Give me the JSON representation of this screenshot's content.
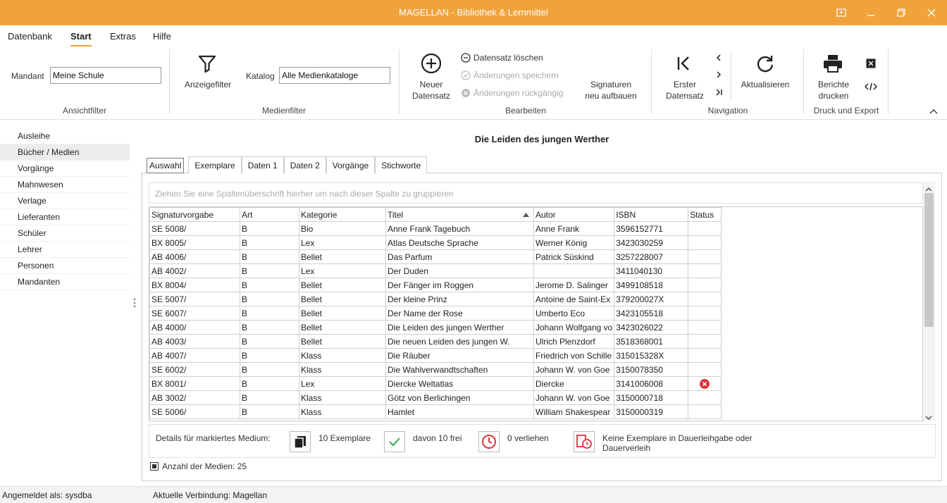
{
  "window": {
    "title": "MAGELLAN - Bibliothek & Lernmittel"
  },
  "menu": [
    "Datenbank",
    "Start",
    "Extras",
    "Hilfe"
  ],
  "ribbon": {
    "mandant_label": "Mandant",
    "mandant_value": "Meine Schule",
    "group_ansichtfilter": "Ansichtfilter",
    "anzeigefilter": "Anzeigefilter",
    "katalog_label": "Katalog",
    "katalog_value": "Alle Medienkataloge",
    "group_medienfilter": "Medienfilter",
    "neuer_datensatz_1": "Neuer",
    "neuer_datensatz_2": "Datensatz",
    "datensatz_loeschen": "Datensatz löschen",
    "aenderungen_speichern": "Änderungen speichern",
    "aenderungen_rueckgaengig": "Änderungen rückgängig",
    "signaturen_1": "Signaturen",
    "signaturen_2": "neu aufbauen",
    "group_bearbeiten": "Bearbeiten",
    "erster_1": "Erster",
    "erster_2": "Datensatz",
    "aktualisieren": "Aktualisieren",
    "group_navigation": "Navigation",
    "berichte_1": "Berichte",
    "berichte_2": "drucken",
    "group_druck": "Druck und Export"
  },
  "sidebar": [
    "Ausleihe",
    "Bücher / Medien",
    "Vorgänge",
    "Mahnwesen",
    "Verlage",
    "Lieferanten",
    "Schüler",
    "Lehrer",
    "Personen",
    "Mandanten"
  ],
  "main": {
    "title": "Die Leiden des jungen Werther",
    "tabs": [
      "Auswahl",
      "Exemplare",
      "Daten 1",
      "Daten 2",
      "Vorgänge",
      "Stichworte"
    ],
    "group_hint": "Ziehen Sie eine Spaltenüberschrift hierher um nach dieser Spalte zu gruppieren",
    "columns": [
      "Signaturvorgabe",
      "Art",
      "Kategorie",
      "Titel",
      "Autor",
      "ISBN",
      "Status"
    ],
    "rows": [
      [
        "SE 5008/",
        "B",
        "Bio",
        "Anne Frank Tagebuch",
        "Anne Frank",
        "3596152771",
        ""
      ],
      [
        "BX 8005/",
        "B",
        "Lex",
        "Atlas Deutsche Sprache",
        "Werner König",
        "3423030259",
        ""
      ],
      [
        "AB 4006/",
        "B",
        "Bellet",
        "Das Parfum",
        "Patrick Süskind",
        "3257228007",
        ""
      ],
      [
        "AB 4002/",
        "B",
        "Lex",
        "Der Duden",
        "",
        "3411040130",
        ""
      ],
      [
        "BX 8004/",
        "B",
        "Bellet",
        "Der Fänger im Roggen",
        "Jerome D. Salinger",
        "3499108518",
        ""
      ],
      [
        "SE 5007/",
        "B",
        "Bellet",
        "Der kleine Prinz",
        "Antoine de Saint-Ex",
        "379200027X",
        ""
      ],
      [
        "SE 6007/",
        "B",
        "Bellet",
        "Der Name der Rose",
        "Umberto Eco",
        "3423105518",
        ""
      ],
      [
        "AB 4000/",
        "B",
        "Bellet",
        "Die Leiden des jungen Werther",
        "Johann Wolfgang vo",
        "3423026022",
        ""
      ],
      [
        "AB 4003/",
        "B",
        "Bellet",
        "Die neuen Leiden des jungen W.",
        "Ulrich Plenzdorf",
        "3518368001",
        ""
      ],
      [
        "AB 4007/",
        "B",
        "Klass",
        "Die Räuber",
        "Friedrich von Schille",
        "315015328X",
        ""
      ],
      [
        "SE 6002/",
        "B",
        "Klass",
        "Die Wahlverwandtschaften",
        "Johann W. von Goe",
        "3150078350",
        ""
      ],
      [
        "BX 8001/",
        "B",
        "Lex",
        "Diercke Weltatlas",
        "Diercke",
        "3141006008",
        "error"
      ],
      [
        "AB 3002/",
        "B",
        "Klass",
        "Götz von Berlichingen",
        "Johann W. von Goe",
        "3150000718",
        ""
      ],
      [
        "SE 5006/",
        "B",
        "Klass",
        "Hamlet",
        "William Shakespear",
        "3150000319",
        ""
      ]
    ]
  },
  "details": {
    "label": "Details für markiertes Medium:",
    "exemplare": "10 Exemplare",
    "frei": "davon 10 frei",
    "verliehen": "0 verliehen",
    "dauer_1": "Keine Exemplare in Dauerleihgabe oder",
    "dauer_2": "Dauerverleih"
  },
  "count": "Anzahl der Medien: 25",
  "status": {
    "user": "Angemeldet als: sysdba",
    "connection": "Aktuelle Verbindung: Magellan"
  },
  "colors": {
    "accent": "#f0a33b",
    "error": "#d9363e",
    "check": "#3aa655"
  }
}
